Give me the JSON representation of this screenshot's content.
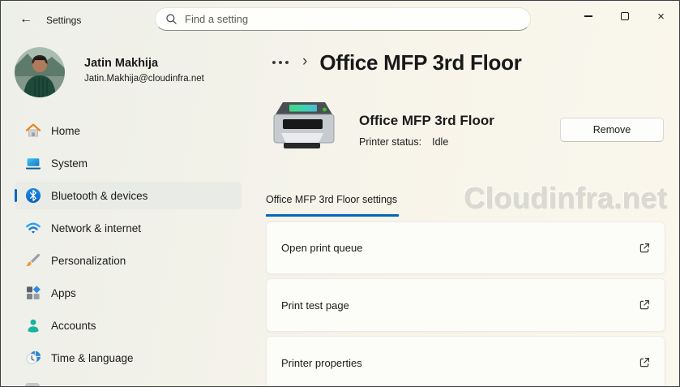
{
  "colors": {
    "accent": "#0067c0",
    "watermark_gray": "#dbdad2",
    "selected_item_bg": "#e9ebe6"
  },
  "titlebar": {
    "app_title": "Settings",
    "close_glyph": "×"
  },
  "icons": {
    "back": "arrow-left",
    "search": "magnifier",
    "minimize": "horizontal-line",
    "maximize": "square-outline",
    "close": "x",
    "breadcrumb_more": "three-dots",
    "breadcrumb_separator": "›",
    "external_link": "open-in-new-window"
  },
  "search": {
    "placeholder": "Find a setting"
  },
  "user": {
    "name": "Jatin Makhija",
    "email": "Jatin.Makhija@cloudinfra.net"
  },
  "sidebar": {
    "items": [
      {
        "label": "Home",
        "icon": "home-icon",
        "selected": false
      },
      {
        "label": "System",
        "icon": "system-icon",
        "selected": false
      },
      {
        "label": "Bluetooth & devices",
        "icon": "bluetooth-icon",
        "selected": true
      },
      {
        "label": "Network & internet",
        "icon": "network-icon",
        "selected": false
      },
      {
        "label": "Personalization",
        "icon": "personalization-icon",
        "selected": false
      },
      {
        "label": "Apps",
        "icon": "apps-icon",
        "selected": false
      },
      {
        "label": "Accounts",
        "icon": "accounts-icon",
        "selected": false
      },
      {
        "label": "Time & language",
        "icon": "time-language-icon",
        "selected": false
      }
    ]
  },
  "page": {
    "breadcrumb_separator": "›",
    "breadcrumb_title": "Office MFP 3rd Floor",
    "printer": {
      "name": "Office MFP 3rd Floor",
      "status_label": "Printer status:",
      "status_value": "Idle"
    },
    "remove_button": "Remove",
    "tab_label": "Office MFP 3rd Floor settings",
    "watermark": "Cloudinfra.net",
    "settings_links": [
      {
        "label": "Open print queue"
      },
      {
        "label": "Print test page"
      },
      {
        "label": "Printer properties"
      }
    ]
  }
}
